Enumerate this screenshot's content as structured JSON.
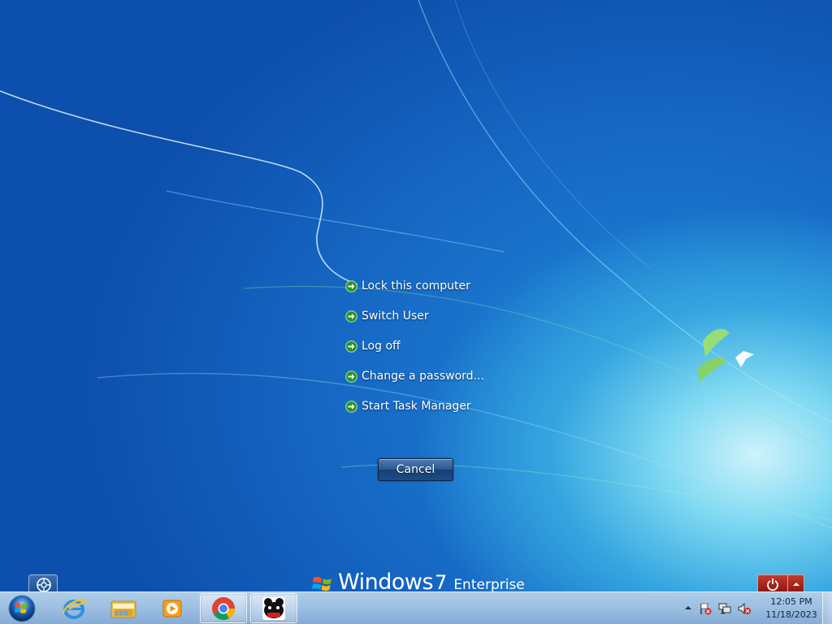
{
  "security_options": [
    {
      "label": "Lock this computer"
    },
    {
      "label": "Switch User"
    },
    {
      "label": "Log off"
    },
    {
      "label": "Change a password..."
    },
    {
      "label": "Start Task Manager"
    }
  ],
  "cancel_label": "Cancel",
  "branding": {
    "word": "Windows",
    "version": "7",
    "edition": "Enterprise"
  },
  "taskbar": {
    "pinned": [
      {
        "name": "internet-explorer",
        "icon": "ie-icon"
      },
      {
        "name": "windows-explorer",
        "icon": "folder-icon"
      },
      {
        "name": "media-player",
        "icon": "media-player-icon"
      },
      {
        "name": "chrome",
        "icon": "chrome-icon"
      },
      {
        "name": "ucn-app",
        "icon": "ucn-icon"
      }
    ]
  },
  "clock": {
    "time": "12:05 PM",
    "date": "11/18/2023"
  },
  "colors": {
    "accent_arrow": "#3fd23a",
    "shutdown_red": "#b0281e",
    "cancel_blue": "#2b5a92"
  }
}
